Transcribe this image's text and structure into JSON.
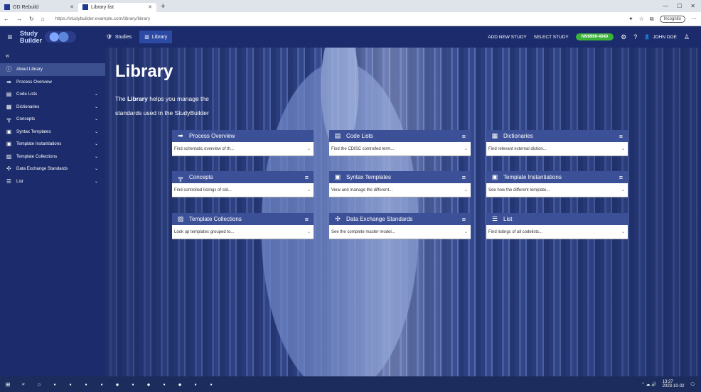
{
  "browser": {
    "tabs": [
      {
        "label": "OD Rebuild"
      },
      {
        "label": "Library list"
      }
    ],
    "url": "https://studybuilder.example.com/library/library",
    "profile": "Incognito"
  },
  "header": {
    "nav": [
      {
        "label": "Studies",
        "icon": "shield-check-icon"
      },
      {
        "label": "Library",
        "icon": "library-icon"
      }
    ],
    "add_new_study": "ADD NEW STUDY",
    "select_study": "SELECT STUDY",
    "study_pill": "NN9999-4040",
    "user": "JOHN DOE"
  },
  "sidebar": {
    "items": [
      {
        "label": "About Library",
        "icon": "info-icon",
        "chevron": false
      },
      {
        "label": "Process Overview",
        "icon": "arrow-right-icon",
        "chevron": false
      },
      {
        "label": "Code Lists",
        "icon": "code-list-icon",
        "chevron": true
      },
      {
        "label": "Dictionaries",
        "icon": "book-icon",
        "chevron": true
      },
      {
        "label": "Concepts",
        "icon": "hierarchy-icon",
        "chevron": true
      },
      {
        "label": "Syntax Templates",
        "icon": "template-icon",
        "chevron": true
      },
      {
        "label": "Template Instantiations",
        "icon": "template-inst-icon",
        "chevron": true
      },
      {
        "label": "Template Collections",
        "icon": "folder-icon",
        "chevron": true
      },
      {
        "label": "Data Exchange Standards",
        "icon": "exchange-icon",
        "chevron": true
      },
      {
        "label": "List",
        "icon": "list-icon",
        "chevron": true
      }
    ]
  },
  "main": {
    "title": "Library",
    "desc_prefix": "The",
    "desc_bold": "Library",
    "desc_suffix": "helps you manage the standards used in the StudyBuilder",
    "cards": [
      {
        "title": "Process Overview",
        "icon": "arrow-right-icon",
        "body": "Find schematic overview of th..."
      },
      {
        "title": "Code Lists",
        "icon": "code-list-icon",
        "body": "Find the CDISC controlled term..."
      },
      {
        "title": "Dictionaries",
        "icon": "book-icon",
        "body": "Find relevant external diction..."
      },
      {
        "title": "Concepts",
        "icon": "hierarchy-icon",
        "body": "Find controlled listings of std..."
      },
      {
        "title": "Syntax Templates",
        "icon": "template-icon",
        "body": "View and manage the different..."
      },
      {
        "title": "Template Instantiations",
        "icon": "template-inst-icon",
        "body": "See how the different template..."
      },
      {
        "title": "Template Collections",
        "icon": "folder-icon",
        "body": "Look up templates grouped to..."
      },
      {
        "title": "Data Exchange Standards",
        "icon": "exchange-icon",
        "body": "See the complete master model..."
      },
      {
        "title": "List",
        "icon": "list-icon",
        "body": "Find listings of all codelists..."
      }
    ]
  },
  "taskbar": {
    "time": "13:27",
    "date": "2023-10-02"
  },
  "colors": {
    "appbar": "#1b2b6b",
    "card_head": "#3c5097",
    "study_pill": "#3bb33b"
  }
}
